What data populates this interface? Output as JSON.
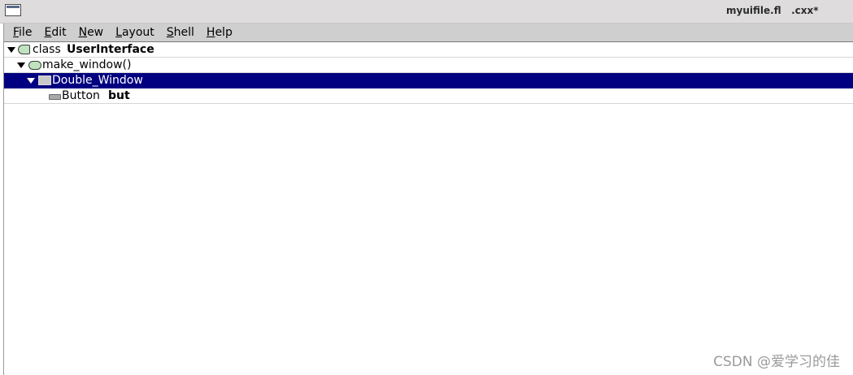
{
  "window": {
    "title": "myuifile.fl   .cxx*"
  },
  "menubar": {
    "items": [
      "File",
      "Edit",
      "New",
      "Layout",
      "Shell",
      "Help"
    ]
  },
  "tree": {
    "class_row": {
      "keyword": "class",
      "name": "UserInterface"
    },
    "function_row": {
      "label": "make_window()"
    },
    "window_row": {
      "label": "Double_Window"
    },
    "button_row": {
      "type": "Button",
      "name": "but"
    }
  },
  "watermark": "CSDN @爱学习的佳",
  "icons": [
    "window-menu-icon",
    "expand-triangle-icon",
    "class-icon",
    "function-icon",
    "window-icon",
    "button-icon"
  ],
  "colors": {
    "selection": "#000080",
    "menubar": "#cfcfcf",
    "titlebar": "#dedcdc"
  }
}
